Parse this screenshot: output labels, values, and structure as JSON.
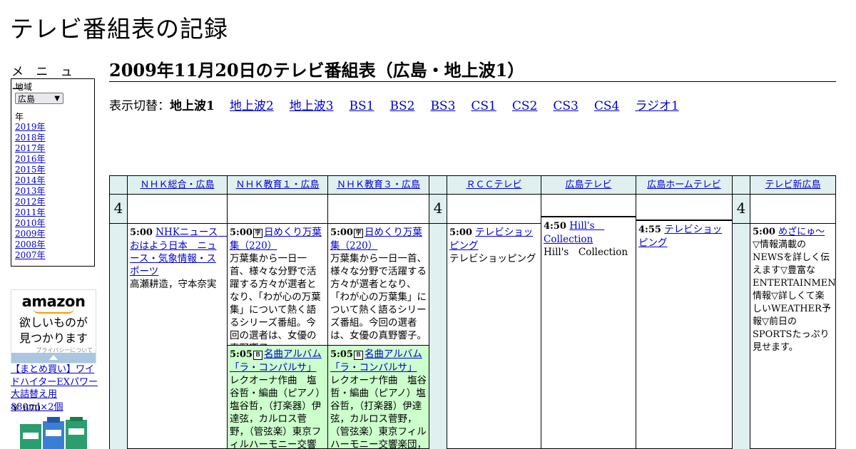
{
  "site": {
    "title": "テレビ番組表の記録"
  },
  "sidebar": {
    "menu_heading": "メ ニ ュ ー",
    "region_label": "地域",
    "region_selected": "広島",
    "year_label": "年",
    "years": [
      "2019年",
      "2018年",
      "2017年",
      "2016年",
      "2015年",
      "2014年",
      "2013年",
      "2012年",
      "2011年",
      "2010年",
      "2009年",
      "2008年",
      "2007年"
    ]
  },
  "ad": {
    "brand": "amazon",
    "tagline_line1": "欲しいものが",
    "tagline_line2": "見つかります",
    "privacy": "プライバシーについて",
    "product_title": "【まとめ買い】ワイドハイターEXパワー 大詰替え用880ml×2個",
    "product_price": "￥ 670"
  },
  "main": {
    "page_title": "2009年11月20日のテレビ番組表（広島・地上波1）",
    "switcher_label": "表示切替：",
    "switcher_current": "地上波1",
    "switcher_links": [
      "地上波2",
      "地上波3",
      "BS1",
      "BS2",
      "BS3",
      "CS1",
      "CS2",
      "CS3",
      "CS4",
      "ラジオ1"
    ]
  },
  "schedule": {
    "hour": "4",
    "channels": [
      "ＮＨＫ総合・広島",
      "ＮＨＫ教育１・広島",
      "ＮＨＫ教育３・広島",
      "ＲＣＣテレビ",
      "広島テレビ",
      "広島ホームテレビ",
      "テレビ新広島"
    ],
    "programs": {
      "nhk_sogo_1": {
        "time": "5:00",
        "title": "NHKニュース　おはよう日本　ニュース・気象情報・スポーツ",
        "desc": "高瀬耕造，守本奈実"
      },
      "nhk_edu1_1": {
        "time": "5:00",
        "badge": "字",
        "title": "日めくり万葉集（220）",
        "desc": "万葉集から一日一首、様々な分野で活躍する方々が選者となり、「わが心の万葉集」について熱く語るシリーズ番組。今回の選者は、女優の真野響子。"
      },
      "nhk_edu1_2": {
        "time": "5:05",
        "badge": "Ｂ",
        "title": "名曲アルバム「ラ・コンパルサ」",
        "desc": "レクオーナ作曲　塩谷哲・編曲（ピアノ）塩谷哲，（打楽器）伊達弦，カルロス菅野，（管弦楽）東京フィルハーモニー交響楽団，"
      },
      "nhk_edu3_1": {
        "time": "5:00",
        "badge": "字",
        "title": "日めくり万葉集（220）",
        "desc": "万葉集から一日一首、様々な分野で活躍する方々が選者となり、「わが心の万葉集」について熱く語るシリーズ番組。今回の選者は、女優の真野響子。"
      },
      "nhk_edu3_2": {
        "time": "5:05",
        "badge": "Ｂ",
        "title": "名曲アルバム「ラ・コンパルサ」",
        "desc": "レクオーナ作曲　塩谷哲・編曲（ピアノ）塩谷哲，（打楽器）伊達弦，カルロス菅野，（管弦楽）東京フィルハーモニー交響楽団，"
      },
      "rcc_1": {
        "time": "5:00",
        "title": "テレビショッピング",
        "desc": "テレビショッピング"
      },
      "htv_1": {
        "time": "4:50",
        "title": "Hill's　Collection",
        "desc": "Hill's　Collection"
      },
      "hometv_1": {
        "time": "4:55",
        "title": "テレビショッピング",
        "desc": ""
      },
      "tss_1": {
        "time": "5:00",
        "title": "めざにゅ～",
        "desc": "▽情報満載のNEWSを詳しく伝えます▽豊富なENTERTAINMENT情報▽詳しくて楽しいWEATHER予報▽前日のSPORTSたっぷり見せます。"
      }
    }
  }
}
